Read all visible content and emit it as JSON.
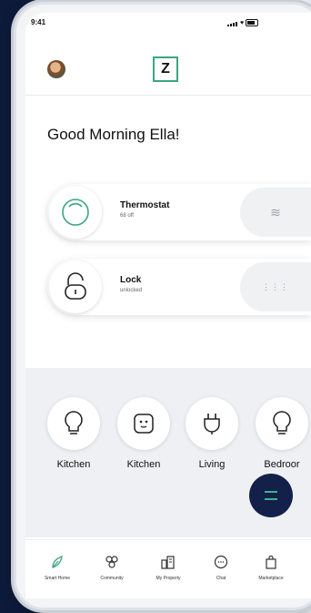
{
  "status_bar": {
    "time": "9:41"
  },
  "header": {
    "logo_letter": "Z"
  },
  "greeting": "Good Morning Ella!",
  "devices": [
    {
      "name": "Thermostat",
      "status": "68 off"
    },
    {
      "name": "Lock",
      "status": "unlocked"
    }
  ],
  "rooms": [
    {
      "label": "Kitchen",
      "icon": "bulb-icon"
    },
    {
      "label": "Kitchen",
      "icon": "outlet-icon"
    },
    {
      "label": "Living",
      "icon": "plug-icon"
    },
    {
      "label": "Bedroor",
      "icon": "bulb-icon"
    }
  ],
  "bottom_nav": [
    {
      "label": "Smart Home",
      "icon": "smart-home-icon"
    },
    {
      "label": "Community",
      "icon": "community-icon"
    },
    {
      "label": "My Property",
      "icon": "property-icon"
    },
    {
      "label": "Chat",
      "icon": "chat-icon"
    },
    {
      "label": "Marketplace",
      "icon": "marketplace-icon"
    }
  ],
  "colors": {
    "accent": "#3ca582",
    "fab": "#13204a",
    "background": "#0d1a3a"
  }
}
